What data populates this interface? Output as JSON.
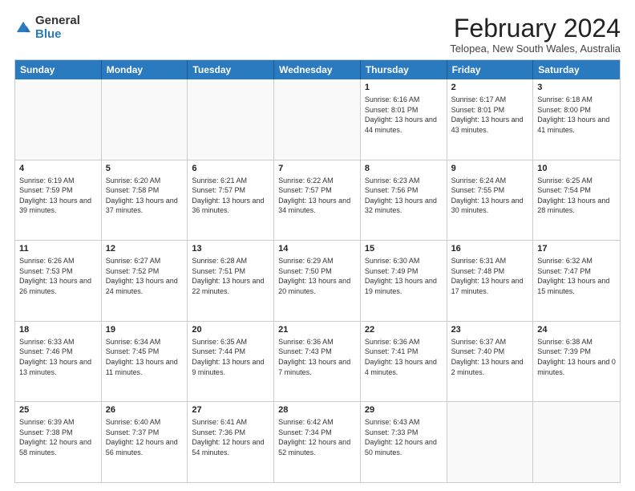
{
  "logo": {
    "general": "General",
    "blue": "Blue"
  },
  "title": "February 2024",
  "subtitle": "Telopea, New South Wales, Australia",
  "headers": [
    "Sunday",
    "Monday",
    "Tuesday",
    "Wednesday",
    "Thursday",
    "Friday",
    "Saturday"
  ],
  "weeks": [
    [
      {
        "day": "",
        "text": ""
      },
      {
        "day": "",
        "text": ""
      },
      {
        "day": "",
        "text": ""
      },
      {
        "day": "",
        "text": ""
      },
      {
        "day": "1",
        "text": "Sunrise: 6:16 AM\nSunset: 8:01 PM\nDaylight: 13 hours and 44 minutes."
      },
      {
        "day": "2",
        "text": "Sunrise: 6:17 AM\nSunset: 8:01 PM\nDaylight: 13 hours and 43 minutes."
      },
      {
        "day": "3",
        "text": "Sunrise: 6:18 AM\nSunset: 8:00 PM\nDaylight: 13 hours and 41 minutes."
      }
    ],
    [
      {
        "day": "4",
        "text": "Sunrise: 6:19 AM\nSunset: 7:59 PM\nDaylight: 13 hours and 39 minutes."
      },
      {
        "day": "5",
        "text": "Sunrise: 6:20 AM\nSunset: 7:58 PM\nDaylight: 13 hours and 37 minutes."
      },
      {
        "day": "6",
        "text": "Sunrise: 6:21 AM\nSunset: 7:57 PM\nDaylight: 13 hours and 36 minutes."
      },
      {
        "day": "7",
        "text": "Sunrise: 6:22 AM\nSunset: 7:57 PM\nDaylight: 13 hours and 34 minutes."
      },
      {
        "day": "8",
        "text": "Sunrise: 6:23 AM\nSunset: 7:56 PM\nDaylight: 13 hours and 32 minutes."
      },
      {
        "day": "9",
        "text": "Sunrise: 6:24 AM\nSunset: 7:55 PM\nDaylight: 13 hours and 30 minutes."
      },
      {
        "day": "10",
        "text": "Sunrise: 6:25 AM\nSunset: 7:54 PM\nDaylight: 13 hours and 28 minutes."
      }
    ],
    [
      {
        "day": "11",
        "text": "Sunrise: 6:26 AM\nSunset: 7:53 PM\nDaylight: 13 hours and 26 minutes."
      },
      {
        "day": "12",
        "text": "Sunrise: 6:27 AM\nSunset: 7:52 PM\nDaylight: 13 hours and 24 minutes."
      },
      {
        "day": "13",
        "text": "Sunrise: 6:28 AM\nSunset: 7:51 PM\nDaylight: 13 hours and 22 minutes."
      },
      {
        "day": "14",
        "text": "Sunrise: 6:29 AM\nSunset: 7:50 PM\nDaylight: 13 hours and 20 minutes."
      },
      {
        "day": "15",
        "text": "Sunrise: 6:30 AM\nSunset: 7:49 PM\nDaylight: 13 hours and 19 minutes."
      },
      {
        "day": "16",
        "text": "Sunrise: 6:31 AM\nSunset: 7:48 PM\nDaylight: 13 hours and 17 minutes."
      },
      {
        "day": "17",
        "text": "Sunrise: 6:32 AM\nSunset: 7:47 PM\nDaylight: 13 hours and 15 minutes."
      }
    ],
    [
      {
        "day": "18",
        "text": "Sunrise: 6:33 AM\nSunset: 7:46 PM\nDaylight: 13 hours and 13 minutes."
      },
      {
        "day": "19",
        "text": "Sunrise: 6:34 AM\nSunset: 7:45 PM\nDaylight: 13 hours and 11 minutes."
      },
      {
        "day": "20",
        "text": "Sunrise: 6:35 AM\nSunset: 7:44 PM\nDaylight: 13 hours and 9 minutes."
      },
      {
        "day": "21",
        "text": "Sunrise: 6:36 AM\nSunset: 7:43 PM\nDaylight: 13 hours and 7 minutes."
      },
      {
        "day": "22",
        "text": "Sunrise: 6:36 AM\nSunset: 7:41 PM\nDaylight: 13 hours and 4 minutes."
      },
      {
        "day": "23",
        "text": "Sunrise: 6:37 AM\nSunset: 7:40 PM\nDaylight: 13 hours and 2 minutes."
      },
      {
        "day": "24",
        "text": "Sunrise: 6:38 AM\nSunset: 7:39 PM\nDaylight: 13 hours and 0 minutes."
      }
    ],
    [
      {
        "day": "25",
        "text": "Sunrise: 6:39 AM\nSunset: 7:38 PM\nDaylight: 12 hours and 58 minutes."
      },
      {
        "day": "26",
        "text": "Sunrise: 6:40 AM\nSunset: 7:37 PM\nDaylight: 12 hours and 56 minutes."
      },
      {
        "day": "27",
        "text": "Sunrise: 6:41 AM\nSunset: 7:36 PM\nDaylight: 12 hours and 54 minutes."
      },
      {
        "day": "28",
        "text": "Sunrise: 6:42 AM\nSunset: 7:34 PM\nDaylight: 12 hours and 52 minutes."
      },
      {
        "day": "29",
        "text": "Sunrise: 6:43 AM\nSunset: 7:33 PM\nDaylight: 12 hours and 50 minutes."
      },
      {
        "day": "",
        "text": ""
      },
      {
        "day": "",
        "text": ""
      }
    ]
  ]
}
